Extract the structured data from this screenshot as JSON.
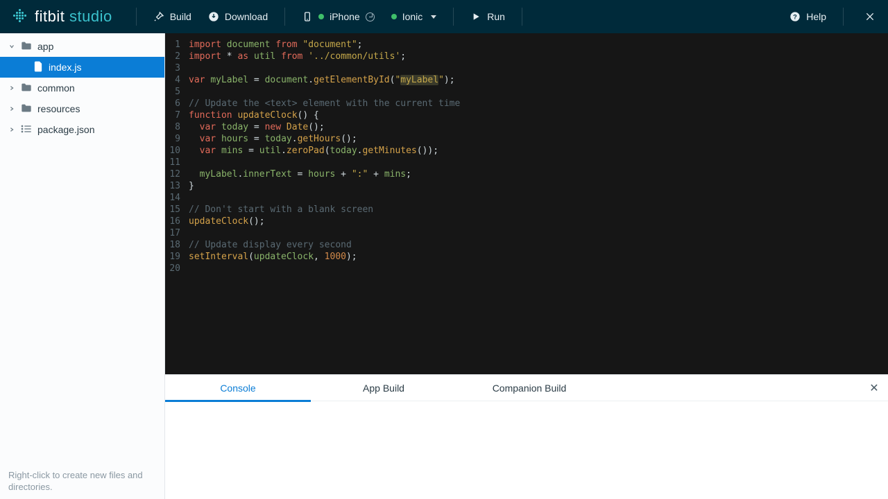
{
  "brand": {
    "name1": "fitbit",
    "name2": "studio"
  },
  "topbar": {
    "build": "Build",
    "download": "Download",
    "phone": "iPhone",
    "watch": "Ionic",
    "run": "Run",
    "help": "Help"
  },
  "sidebar": {
    "items": [
      {
        "label": "app",
        "kind": "folder",
        "expanded": true
      },
      {
        "label": "index.js",
        "kind": "file",
        "child": true,
        "selected": true
      },
      {
        "label": "common",
        "kind": "folder",
        "expanded": false
      },
      {
        "label": "resources",
        "kind": "folder",
        "expanded": false
      },
      {
        "label": "package.json",
        "kind": "list",
        "expanded": false
      }
    ],
    "hint": "Right-click to create new files and directories."
  },
  "editor": {
    "lines": [
      [
        [
          "kw",
          "import"
        ],
        [
          "op",
          " "
        ],
        [
          "id",
          "document"
        ],
        [
          "op",
          " "
        ],
        [
          "kw",
          "from"
        ],
        [
          "op",
          " "
        ],
        [
          "str",
          "\"document\""
        ],
        [
          "op",
          ";"
        ]
      ],
      [
        [
          "kw",
          "import"
        ],
        [
          "op",
          " * "
        ],
        [
          "kw",
          "as"
        ],
        [
          "op",
          " "
        ],
        [
          "id",
          "util"
        ],
        [
          "op",
          " "
        ],
        [
          "kw",
          "from"
        ],
        [
          "op",
          " "
        ],
        [
          "str",
          "'../common/utils'"
        ],
        [
          "op",
          ";"
        ]
      ],
      [],
      [
        [
          "kw",
          "var"
        ],
        [
          "op",
          " "
        ],
        [
          "id",
          "myLabel"
        ],
        [
          "op",
          " = "
        ],
        [
          "id",
          "document"
        ],
        [
          "op",
          "."
        ],
        [
          "fn",
          "getElementById"
        ],
        [
          "op",
          "("
        ],
        [
          "str",
          "\""
        ],
        [
          "str hl",
          "myLabel"
        ],
        [
          "str",
          "\""
        ],
        [
          "op",
          ");"
        ]
      ],
      [],
      [
        [
          "cmt",
          "// Update the <text> element with the current time"
        ]
      ],
      [
        [
          "kw",
          "function"
        ],
        [
          "op",
          " "
        ],
        [
          "fn",
          "updateClock"
        ],
        [
          "op",
          "() {"
        ]
      ],
      [
        [
          "op",
          "  "
        ],
        [
          "kw",
          "var"
        ],
        [
          "op",
          " "
        ],
        [
          "id",
          "today"
        ],
        [
          "op",
          " = "
        ],
        [
          "new",
          "new"
        ],
        [
          "op",
          " "
        ],
        [
          "fn",
          "Date"
        ],
        [
          "op",
          "();"
        ]
      ],
      [
        [
          "op",
          "  "
        ],
        [
          "kw",
          "var"
        ],
        [
          "op",
          " "
        ],
        [
          "id",
          "hours"
        ],
        [
          "op",
          " = "
        ],
        [
          "id",
          "today"
        ],
        [
          "op",
          "."
        ],
        [
          "fn",
          "getHours"
        ],
        [
          "op",
          "();"
        ]
      ],
      [
        [
          "op",
          "  "
        ],
        [
          "kw",
          "var"
        ],
        [
          "op",
          " "
        ],
        [
          "id",
          "mins"
        ],
        [
          "op",
          " = "
        ],
        [
          "id",
          "util"
        ],
        [
          "op",
          "."
        ],
        [
          "fn",
          "zeroPad"
        ],
        [
          "op",
          "("
        ],
        [
          "id",
          "today"
        ],
        [
          "op",
          "."
        ],
        [
          "fn",
          "getMinutes"
        ],
        [
          "op",
          "());"
        ]
      ],
      [],
      [
        [
          "op",
          "  "
        ],
        [
          "id",
          "myLabel"
        ],
        [
          "op",
          "."
        ],
        [
          "id",
          "innerText"
        ],
        [
          "op",
          " = "
        ],
        [
          "id",
          "hours"
        ],
        [
          "op",
          " + "
        ],
        [
          "str",
          "\":\""
        ],
        [
          "op",
          " + "
        ],
        [
          "id",
          "mins"
        ],
        [
          "op",
          ";"
        ]
      ],
      [
        [
          "op",
          "}"
        ]
      ],
      [],
      [
        [
          "cmt",
          "// Don't start with a blank screen"
        ]
      ],
      [
        [
          "fn",
          "updateClock"
        ],
        [
          "op",
          "();"
        ]
      ],
      [],
      [
        [
          "cmt",
          "// Update display every second"
        ]
      ],
      [
        [
          "fn",
          "setInterval"
        ],
        [
          "op",
          "("
        ],
        [
          "id",
          "updateClock"
        ],
        [
          "op",
          ", "
        ],
        [
          "num",
          "1000"
        ],
        [
          "op",
          ");"
        ]
      ],
      []
    ]
  },
  "panel": {
    "tabs": [
      "Console",
      "App Build",
      "Companion Build"
    ],
    "active": 0
  }
}
